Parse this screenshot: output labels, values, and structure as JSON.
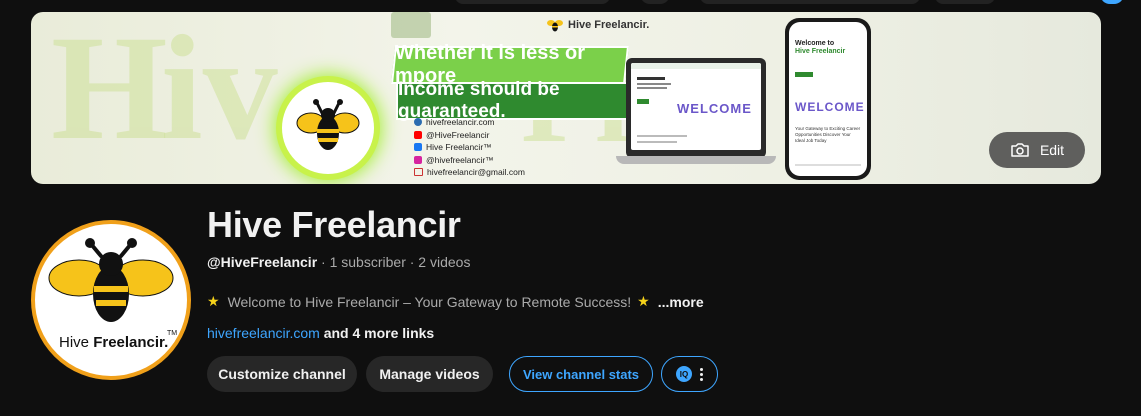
{
  "banner": {
    "brand_name": "Hive Freelancir.",
    "slogan_line1": "Whether it is less or mpore",
    "slogan_line2": "Income should be guaranteed.",
    "contacts": [
      {
        "icon": "globe-icon",
        "text": "hivefreelancir.com",
        "color": "#2b6cb0"
      },
      {
        "icon": "youtube-icon",
        "text": "@HiveFreelancir",
        "color": "#ff0000"
      },
      {
        "icon": "facebook-icon",
        "text": "Hive Freelancir™",
        "color": "#1877f2"
      },
      {
        "icon": "instagram-icon",
        "text": "@hivefreelancir™",
        "color": "#d6249f"
      },
      {
        "icon": "email-icon",
        "text": "hivefreelancir@gmail.com",
        "color": "#444444"
      }
    ],
    "laptop_welcome": "WELCOME",
    "phone_heading": "Welcome to",
    "phone_brand": "Hive Freelancir",
    "phone_welcome": "WELCOME",
    "phone_tagline": "Your Gateway to Exciting Career Opportunities Discover Your Ideal Job Today",
    "edit_label": "Edit"
  },
  "avatar": {
    "wordmark_plain": "Hive ",
    "wordmark_bold": "Freelancir.",
    "tm": "TM"
  },
  "channel": {
    "title": "Hive Freelancir",
    "handle": "@HiveFreelancir",
    "stats": " · 1 subscriber · 2 videos",
    "description": "Welcome to Hive Freelancir – Your Gateway to Remote Success!",
    "more_label": "...more",
    "link": "hivefreelancir.com",
    "more_links": " and 4 more links"
  },
  "actions": {
    "customize": "Customize channel",
    "manage": "Manage videos",
    "stats": "View channel stats",
    "iq_badge": "IQ"
  },
  "colors": {
    "accent_blue": "#3ea6ff",
    "star_yellow": "#f6d21a",
    "avatar_ring": "#f0a01a",
    "slogan_green": "#2f8a2f"
  }
}
